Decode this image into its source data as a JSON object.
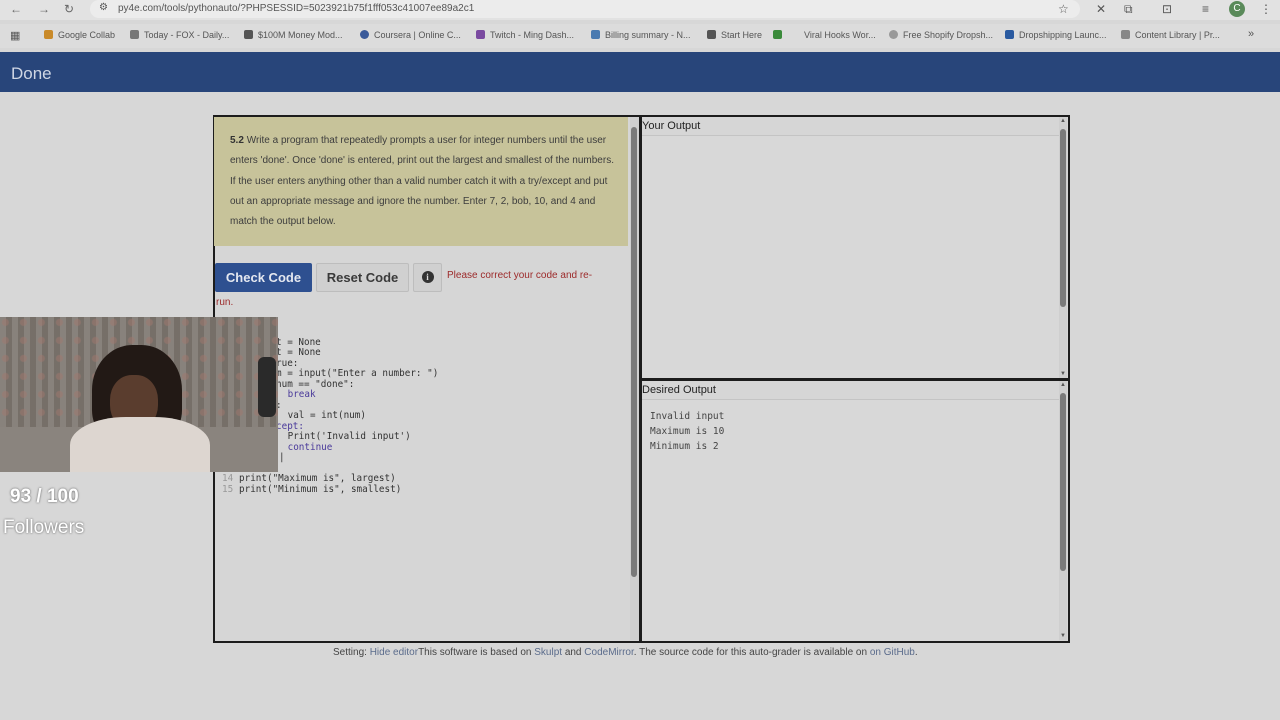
{
  "browser": {
    "url": "py4e.com/tools/pythonauto/?PHPSESSID=5023921b75f1fff053c41007ee89a2c1",
    "profile_initial": "C",
    "bookmarks": [
      "Google Collab",
      "Today - FOX - Daily...",
      "$100M Money Mod...",
      "Coursera | Online C...",
      "Twitch - Ming Dash...",
      "Billing summary - N...",
      "Start Here",
      "Viral Hooks Wor...",
      "Free Shopify Dropsh...",
      "Dropshipping Launc...",
      "Content Library | Pr..."
    ],
    "more_bookmarks": "»"
  },
  "header": {
    "done_label": "Done"
  },
  "problem": {
    "number": "5.2",
    "text": "Write a program that repeatedly prompts a user for integer numbers until the user enters 'done'. Once 'done' is entered, print out the largest and smallest of the numbers. If the user enters anything other than a valid number catch it with a try/except and put out an appropriate message and ignore the number. Enter 7, 2, bob, 10, and 4 and match the output below."
  },
  "actions": {
    "check_label": "Check Code",
    "reset_label": "Reset Code",
    "info_glyph": "i",
    "error_message": "Please correct your code and re-",
    "error_message_cont": "run."
  },
  "editor": {
    "visible_lines": [
      {
        "n": "",
        "text": "t = None"
      },
      {
        "n": "",
        "text": "t = None"
      },
      {
        "n": "",
        "text": "rue:"
      },
      {
        "n": "",
        "text": "m = input(\"Enter a number: \")"
      },
      {
        "n": "",
        "text": "num == \"done\":"
      },
      {
        "n": "",
        "text": " break"
      },
      {
        "n": "",
        "text": ":"
      },
      {
        "n": "",
        "text": " val = int(num)"
      },
      {
        "n": "",
        "text": "cept:"
      },
      {
        "n": "",
        "text": " Print('Invalid input')"
      },
      {
        "n": "",
        "text": " continue"
      },
      {
        "n": "",
        "text": "|"
      },
      {
        "n": "14",
        "text": "print(\"Maximum is\", largest)"
      },
      {
        "n": "15",
        "text": "print(\"Minimum is\", smallest)"
      }
    ]
  },
  "your_output": {
    "title": "Your Output"
  },
  "desired_output": {
    "title": "Desired Output",
    "lines": [
      "Invalid input",
      "Maximum is 10",
      "Minimum is 2"
    ]
  },
  "footer": {
    "setting": "Setting:",
    "hide_editor": "Hide editor",
    "text1": "This software is based on",
    "skulpt": "Skulpt",
    "and": "and",
    "codemirror": "CodeMirror",
    "text2": ". The source code for this auto-grader is available on",
    "github": "on GitHub",
    "period": "."
  },
  "stream_overlay": {
    "followers_count": "93 / 100",
    "followers_label": "Followers"
  }
}
